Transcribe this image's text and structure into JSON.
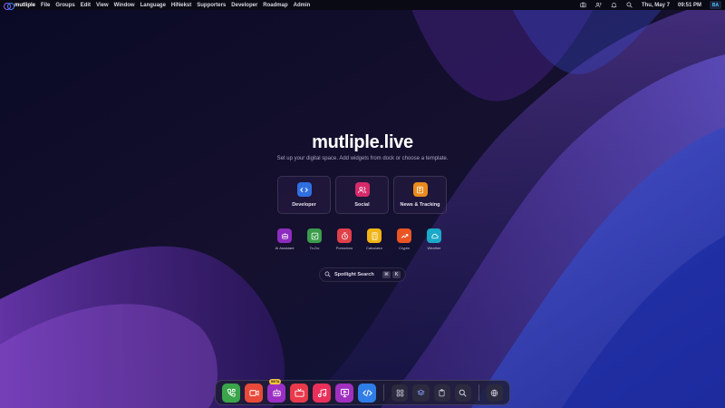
{
  "menubar": {
    "brand": "mutliple",
    "items": [
      "File",
      "Groups",
      "Edit",
      "View",
      "Window",
      "Language",
      "HiNekst",
      "Supporters",
      "Developer",
      "Roadmap",
      "Admin"
    ],
    "date": "Thu, May 7",
    "time": "09:51 PM",
    "avatar_initials": "BA",
    "icons": [
      "camera-icon",
      "users-icon",
      "bell-icon",
      "search-icon"
    ]
  },
  "hero": {
    "title": "mutliple.live",
    "subtitle": "Set up your digital space. Add widgets from dock or choose a template."
  },
  "templates": [
    {
      "label": "Developer",
      "icon": "code-icon",
      "color": "#2f6fe0"
    },
    {
      "label": "Social",
      "icon": "users-icon",
      "color": "#d62a6b"
    },
    {
      "label": "News & Tracking",
      "icon": "newspaper-icon",
      "color": "#e98a1c"
    }
  ],
  "widgets": [
    {
      "label": "AI Assistant",
      "icon": "robot-icon",
      "color": "#8e2bbf"
    },
    {
      "label": "To-Do",
      "icon": "checkbox-icon",
      "color": "#3a9c4a"
    },
    {
      "label": "Pomodoro",
      "icon": "timer-icon",
      "color": "#e0404a"
    },
    {
      "label": "Calculator",
      "icon": "calculator-icon",
      "color": "#f0b416"
    },
    {
      "label": "Crypto",
      "icon": "trend-icon",
      "color": "#ea5423"
    },
    {
      "label": "Weather",
      "icon": "cloud-icon",
      "color": "#1aa9c9"
    }
  ],
  "spotlight": {
    "label": "Spotlight Search",
    "keys": [
      "⌘",
      "K"
    ]
  },
  "dock": {
    "beta_label": "BETA",
    "apps": [
      {
        "icon": "phone-video-icon",
        "color": "#3aa54a"
      },
      {
        "icon": "video-camera-icon",
        "color": "#e84a3a"
      },
      {
        "icon": "robot-icon",
        "color": "#9b2fc4",
        "beta": true
      },
      {
        "icon": "tv-icon",
        "color": "#e83a4a"
      },
      {
        "icon": "music-icon",
        "color": "#e8305a"
      },
      {
        "icon": "presentation-icon",
        "color": "#a030c0"
      },
      {
        "icon": "code-icon",
        "color": "#2f7ee8"
      }
    ],
    "tools": [
      "grid-icon",
      "layers-icon",
      "clipboard-icon",
      "search-icon"
    ],
    "extra": "globe-icon"
  }
}
